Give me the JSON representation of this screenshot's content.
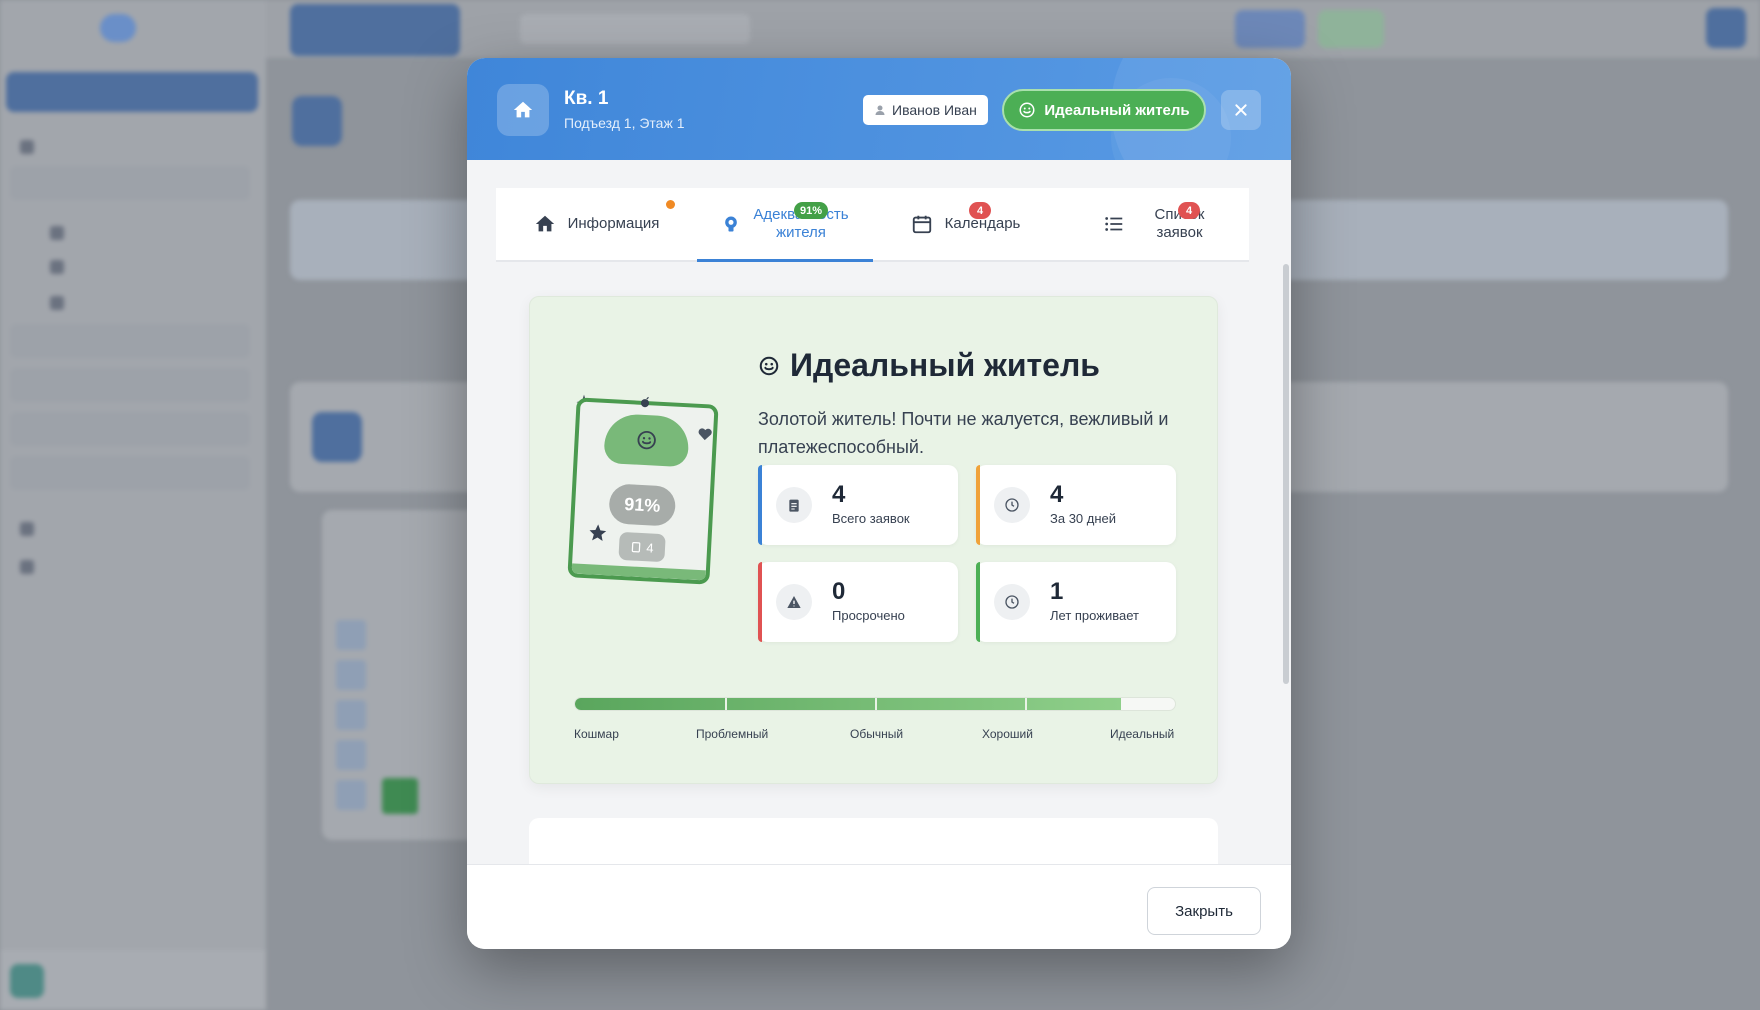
{
  "modal": {
    "title": "Кв. 1",
    "subtitle": "Подъезд 1, Этаж 1",
    "owner": "Иванов Иван",
    "status_badge": "Идеальный житель",
    "icons": {
      "home": "home-icon",
      "user": "user-icon",
      "smile": "smile-icon",
      "close": "close-icon"
    }
  },
  "tabs": [
    {
      "label": "Информация",
      "icon": "home-icon",
      "dot": true,
      "dot_color": "#f08a24"
    },
    {
      "label_line1": "Адекватность",
      "label_line2": "жителя",
      "icon": "brain-icon",
      "badge": "91%",
      "active": true
    },
    {
      "label": "Календарь",
      "icon": "calendar-icon",
      "badge": "4"
    },
    {
      "label_line1": "Список",
      "label_line2": "заявок",
      "icon": "list-icon",
      "badge": "4"
    }
  ],
  "rating": {
    "title": "Идеальный житель",
    "description": "Золотой житель! Почти не жалуется, вежливый и платежеспособный.",
    "card": {
      "percent": "91%",
      "requests": "4"
    },
    "stats": [
      {
        "value": "4",
        "label": "Всего заявок",
        "icon": "clipboard-icon",
        "accent": "#3b82d6"
      },
      {
        "value": "4",
        "label": "За 30 дней",
        "icon": "clock-icon",
        "accent": "#f0a23a"
      },
      {
        "value": "0",
        "label": "Просрочено",
        "icon": "warning-icon",
        "accent": "#e05252"
      },
      {
        "value": "1",
        "label": "Лет проживает",
        "icon": "clock-icon",
        "accent": "#4caf55"
      }
    ],
    "scale": {
      "value_percent": 91,
      "labels": [
        "Кошмар",
        "Проблемный",
        "Обычный",
        "Хороший",
        "Идеальный"
      ]
    }
  },
  "footer": {
    "close_label": "Закрыть"
  },
  "colors": {
    "header": "#3f86d9",
    "success": "#4caf55",
    "accent": "#3b82d6"
  }
}
